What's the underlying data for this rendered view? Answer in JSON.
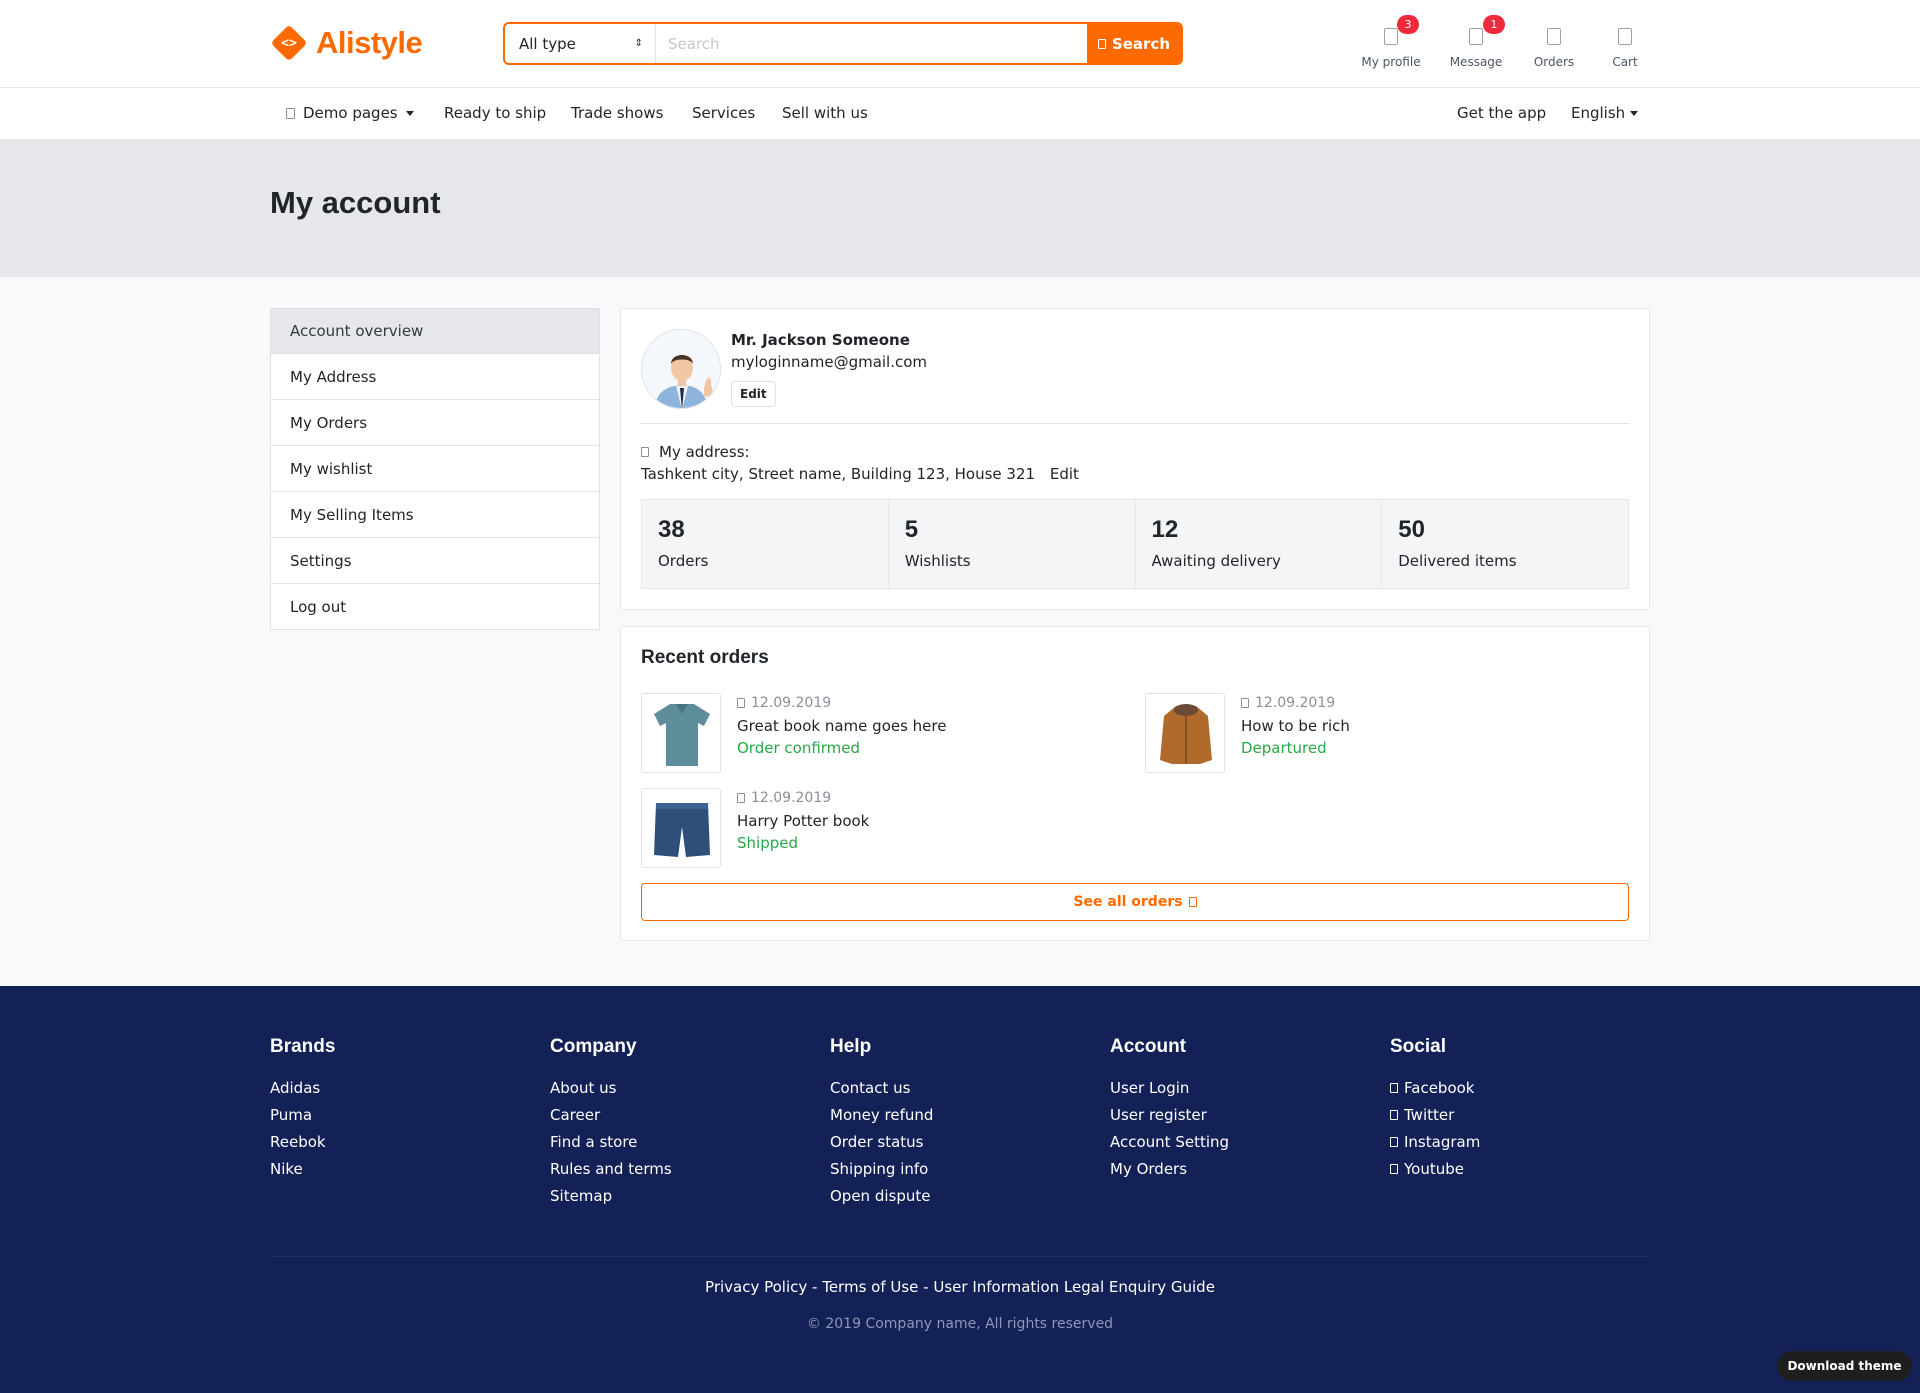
{
  "brand": {
    "name": "Alistyle",
    "logo_glyph": "<>",
    "accent": "#ff6a00"
  },
  "search": {
    "type_value": "All type",
    "placeholder": "Search",
    "button_label": "Search"
  },
  "widgets": [
    {
      "label": "My profile",
      "badge": "3",
      "icon": "user-icon"
    },
    {
      "label": "Message",
      "badge": "1",
      "icon": "comment-icon"
    },
    {
      "label": "Orders",
      "icon": "store-icon"
    },
    {
      "label": "Cart",
      "icon": "cart-icon"
    }
  ],
  "nav": {
    "items": [
      "Demo pages",
      "Ready to ship",
      "Trade shows",
      "Services",
      "Sell with us"
    ],
    "right": [
      "Get the app",
      "English"
    ]
  },
  "page_title": "My account",
  "sidebar": {
    "items": [
      "Account overview",
      "My Address",
      "My Orders",
      "My wishlist",
      "My Selling Items",
      "Settings",
      "Log out"
    ]
  },
  "profile": {
    "name": "Mr. Jackson Someone",
    "email": "myloginname@gmail.com",
    "edit_label": "Edit",
    "address_label": "My address:",
    "address": "Tashkent city, Street name, Building 123, House 321",
    "address_edit": "Edit"
  },
  "stats": [
    {
      "value": "38",
      "label": "Orders"
    },
    {
      "value": "5",
      "label": "Wishlists"
    },
    {
      "value": "12",
      "label": "Awaiting delivery"
    },
    {
      "value": "50",
      "label": "Delivered items"
    }
  ],
  "recent_orders": {
    "title": "Recent orders",
    "orders": [
      {
        "date": "12.09.2019",
        "name": "Great book name goes here",
        "status": "Order confirmed",
        "thumb": "polo-shirt"
      },
      {
        "date": "12.09.2019",
        "name": "How to be rich",
        "status": "Departured",
        "thumb": "jacket"
      },
      {
        "date": "12.09.2019",
        "name": "Harry Potter book",
        "status": "Shipped",
        "thumb": "jeans-shorts"
      }
    ],
    "see_all_label": "See all orders"
  },
  "footer": {
    "columns": [
      {
        "title": "Brands",
        "links": [
          "Adidas",
          "Puma",
          "Reebok",
          "Nike"
        ]
      },
      {
        "title": "Company",
        "links": [
          "About us",
          "Career",
          "Find a store",
          "Rules and terms",
          "Sitemap"
        ]
      },
      {
        "title": "Help",
        "links": [
          "Contact us",
          "Money refund",
          "Order status",
          "Shipping info",
          "Open dispute"
        ]
      },
      {
        "title": "Account",
        "links": [
          "User Login",
          "User register",
          "Account Setting",
          "My Orders"
        ]
      },
      {
        "title": "Social",
        "links": [
          "Facebook",
          "Twitter",
          "Instagram",
          "Youtube"
        ]
      }
    ],
    "legal": "Privacy Policy - Terms of Use - User Information Legal Enquiry Guide",
    "copyright": "© 2019 Company name, All rights reserved"
  },
  "download_theme": "Download theme",
  "colors": {
    "accent": "#ff6a00",
    "footer_bg": "#132157",
    "success": "#28a745",
    "badge": "#ef2b3b"
  }
}
